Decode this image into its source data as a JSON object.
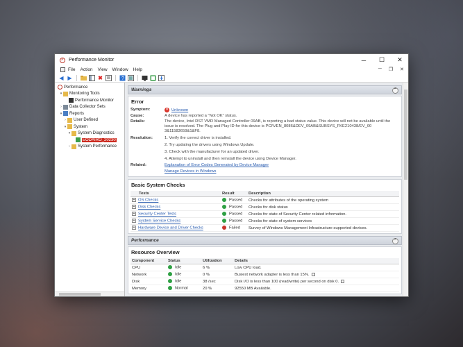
{
  "window": {
    "title": "Performance Monitor",
    "controls": {
      "minimize": "─",
      "maximize": "☐",
      "close": "✕"
    }
  },
  "menu": {
    "items": [
      "File",
      "Action",
      "View",
      "Window",
      "Help"
    ]
  },
  "tree": {
    "performance": "Performance",
    "monitoring_tools": "Monitoring Tools",
    "performance_monitor": "Performance Monitor",
    "data_collector_sets": "Data Collector Sets",
    "reports": "Reports",
    "user_defined": "User Defined",
    "system": "System",
    "system_diagnostics": "System Diagnostics",
    "report_item": "EODAIRO_20230",
    "system_performance": "System Performance"
  },
  "warnings": {
    "header": "Warnings",
    "error_title": "Error",
    "symptom_label": "Symptom:",
    "symptom_value": "Unknown",
    "cause_label": "Cause:",
    "cause_value": "A device has reported a \"Not OK\" status.",
    "details_label": "Details:",
    "details_value": "The device, Intel RST VMD Managed Controller 09AB, is reporting a bad status value. This device will not be available until the issue is resolved. The Plug and Play ID for this device is PCI\\VEN_8086&DEV_09AB&SUBSYS_FKE210438/EV_00 3&11583659&1&F8.",
    "resolution_label": "Resolution:",
    "resolution_steps": [
      "1. Verify the correct driver is installed.",
      "2. Try updating the drivers using Windows Update.",
      "3. Check with the manufacturer for an updated driver.",
      "4. Attempt to uninstall and then reinstall the device using Device Manager."
    ],
    "related_label": "Related:",
    "related_links": [
      "Explanation of Error Codes Generated by Device Manager",
      "Manage Devices in Windows"
    ]
  },
  "basic_checks": {
    "title": "Basic System Checks",
    "columns": [
      "Tests",
      "Result",
      "Description"
    ],
    "rows": [
      {
        "test": "OS Checks",
        "result": "Passed",
        "status": "pass",
        "description": "Checks for attributes of the operating system"
      },
      {
        "test": "Disk Checks",
        "result": "Passed",
        "status": "pass",
        "description": "Checks for disk status"
      },
      {
        "test": "Security Center Tests",
        "result": "Passed",
        "status": "pass",
        "description": "Checks for state of Security Center related information."
      },
      {
        "test": "System Service Checks",
        "result": "Passed",
        "status": "pass",
        "description": "Checks for state of system services"
      },
      {
        "test": "Hardware Device and Driver Checks",
        "result": "Failed",
        "status": "fail",
        "description": "Survey of Windows Management Infrastructure supported devices."
      }
    ]
  },
  "performance": {
    "header": "Performance",
    "resource_title": "Resource Overview",
    "columns": [
      "Component",
      "Status",
      "Utilization",
      "Details"
    ],
    "rows": [
      {
        "component": "CPU",
        "status": "Idle",
        "utilization": "6 %",
        "details": "Low CPU load.",
        "editable": false
      },
      {
        "component": "Network",
        "status": "Idle",
        "utilization": "0 %",
        "details": "Busiest network adapter is less than 15%.",
        "editable": true
      },
      {
        "component": "Disk",
        "status": "Idle",
        "utilization": "38 /sec",
        "details": "Disk I/O is less than 100 (read/write) per second on disk 0.",
        "editable": true
      },
      {
        "component": "Memory",
        "status": "Normal",
        "utilization": "20 %",
        "details": "92550 MB Available.",
        "editable": false
      }
    ]
  },
  "colors": {
    "pass": "#2ea043",
    "fail": "#c9332b",
    "selection": "#cc2a1f",
    "link": "#2a5db0"
  },
  "icons": {
    "toolbar": [
      "back-arrow-icon",
      "forward-arrow-icon",
      "folder-icon",
      "console-tree-icon",
      "delete-icon",
      "properties-icon",
      "help-icon",
      "view-icon",
      "monitor-icon",
      "report-icon",
      "new-icon"
    ]
  }
}
